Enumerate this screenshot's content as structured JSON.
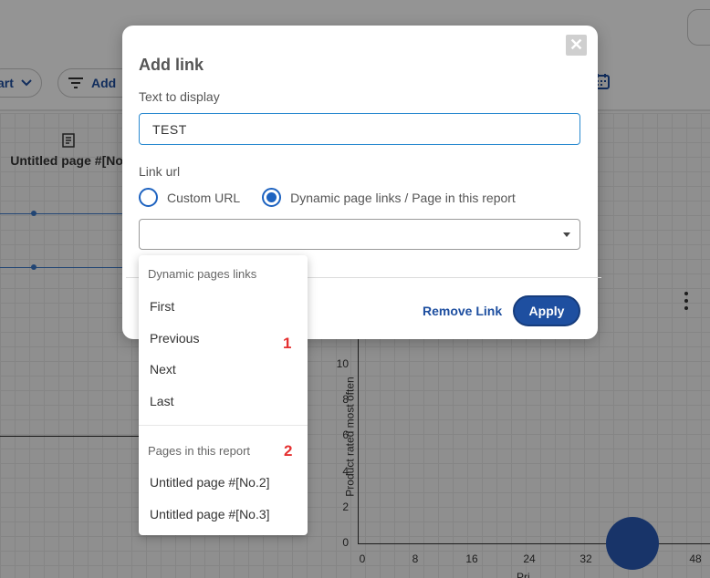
{
  "background": {
    "chart_pill_label": "art",
    "add_pill_label": "Add",
    "page_tab_label": "Untitled page #[No.",
    "chart": {
      "y_ticks": [
        "10",
        "8",
        "6",
        "4",
        "2",
        "0"
      ],
      "x_ticks": [
        "0",
        "8",
        "16",
        "24",
        "32",
        "48"
      ],
      "ylabel": "Product rated most often",
      "xlabel": "Pri",
      "accent": "#2a5bb5"
    }
  },
  "dialog": {
    "title": "Add link",
    "close_symbol": "✕",
    "text_label": "Text to display",
    "text_value": "TEST",
    "url_label": "Link url",
    "radio_custom": "Custom URL",
    "radio_dynamic": "Dynamic page links / Page in this report",
    "select_value": "",
    "remove_label": "Remove Link",
    "apply_label": "Apply",
    "accent": "#1e4fa0"
  },
  "dropdown": {
    "group1_header": "Dynamic pages links",
    "group1_items": [
      "First",
      "Previous",
      "Next",
      "Last"
    ],
    "group1_badge": "1",
    "group2_header": "Pages in this report",
    "group2_items": [
      "Untitled page #[No.2]",
      "Untitled page #[No.3]"
    ],
    "group2_badge": "2",
    "badge_color": "#e53030"
  }
}
